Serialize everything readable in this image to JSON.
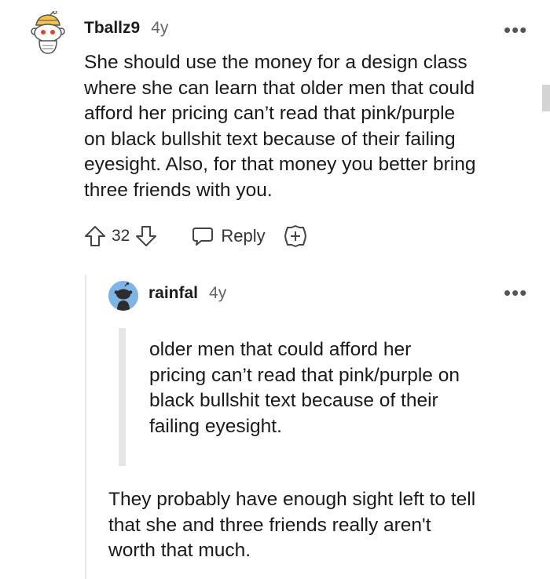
{
  "comment": {
    "username": "Tballz9",
    "age": "4y",
    "more": "•••",
    "lines": [
      "She should use the money for a design class",
      "where she can learn that older men that could",
      "afford her pricing can’t read that pink/purple",
      "on black bullshit text because of their failing",
      "eyesight. Also, for that money you better bring",
      "three friends with you."
    ],
    "votes": "32",
    "reply_label": "Reply",
    "icons": [
      "upvote-icon",
      "downvote-icon",
      "reply-bubble-icon",
      "award-icon"
    ]
  },
  "reply": {
    "username": "rainfal",
    "age": "4y",
    "more": "•••",
    "quote_lines": [
      "older men that could afford her",
      "pricing can’t read that pink/purple on",
      "black bullshit text because of their",
      "failing eyesight."
    ],
    "lines": [
      "They probably have enough sight left to tell",
      "that she and three friends really aren't",
      "worth that much."
    ]
  },
  "colors": {
    "text": "#1a1a1b",
    "muted": "#666666",
    "avatar_blue": "#7fb4e6",
    "quote_bar": "#e6e6e6"
  }
}
